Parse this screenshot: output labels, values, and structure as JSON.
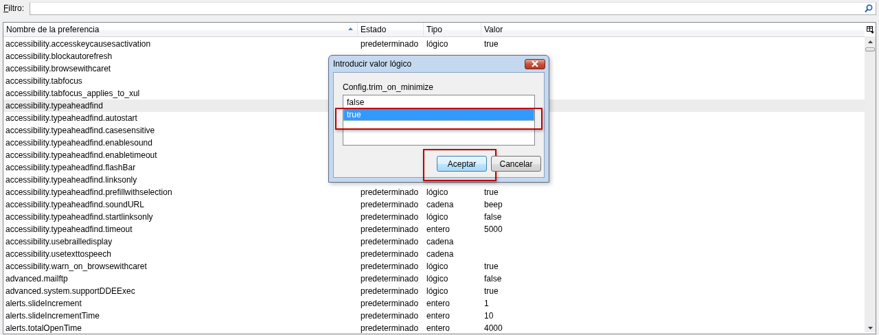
{
  "filter": {
    "label": "Filtro:"
  },
  "table": {
    "columns": [
      {
        "label": "Nombre de la preferencia",
        "sorted": true
      },
      {
        "label": "Estado",
        "sorted": false
      },
      {
        "label": "Tipo",
        "sorted": false
      },
      {
        "label": "Valor",
        "sorted": false
      }
    ],
    "rows": [
      {
        "name": "accessibility.accesskeycausesactivation",
        "estado": "predeterminado",
        "tipo": "lógico",
        "valor": "true",
        "selected": false
      },
      {
        "name": "accessibility.blockautorefresh",
        "selected": false
      },
      {
        "name": "accessibility.browsewithcaret",
        "selected": false
      },
      {
        "name": "accessibility.tabfocus",
        "selected": false
      },
      {
        "name": "accessibility.tabfocus_applies_to_xul",
        "selected": false
      },
      {
        "name": "accessibility.typeaheadfind",
        "selected": true
      },
      {
        "name": "accessibility.typeaheadfind.autostart",
        "selected": false
      },
      {
        "name": "accessibility.typeaheadfind.casesensitive",
        "selected": false
      },
      {
        "name": "accessibility.typeaheadfind.enablesound",
        "selected": false
      },
      {
        "name": "accessibility.typeaheadfind.enabletimeout",
        "selected": false
      },
      {
        "name": "accessibility.typeaheadfind.flashBar",
        "selected": false
      },
      {
        "name": "accessibility.typeaheadfind.linksonly",
        "selected": false
      },
      {
        "name": "accessibility.typeaheadfind.prefillwithselection",
        "estado": "predeterminado",
        "tipo": "lógico",
        "valor": "true",
        "selected": false
      },
      {
        "name": "accessibility.typeaheadfind.soundURL",
        "estado": "predeterminado",
        "tipo": "cadena",
        "valor": "beep",
        "selected": false
      },
      {
        "name": "accessibility.typeaheadfind.startlinksonly",
        "estado": "predeterminado",
        "tipo": "lógico",
        "valor": "false",
        "selected": false
      },
      {
        "name": "accessibility.typeaheadfind.timeout",
        "estado": "predeterminado",
        "tipo": "entero",
        "valor": "5000",
        "selected": false
      },
      {
        "name": "accessibility.usebrailledisplay",
        "estado": "predeterminado",
        "tipo": "cadena",
        "selected": false
      },
      {
        "name": "accessibility.usetexttospeech",
        "estado": "predeterminado",
        "tipo": "cadena",
        "selected": false
      },
      {
        "name": "accessibility.warn_on_browsewithcaret",
        "estado": "predeterminado",
        "tipo": "lógico",
        "valor": "true",
        "selected": false
      },
      {
        "name": "advanced.mailftp",
        "estado": "predeterminado",
        "tipo": "lógico",
        "valor": "false",
        "selected": false
      },
      {
        "name": "advanced.system.supportDDEExec",
        "estado": "predeterminado",
        "tipo": "lógico",
        "valor": "true",
        "selected": false
      },
      {
        "name": "alerts.slideIncrement",
        "estado": "predeterminado",
        "tipo": "entero",
        "valor": "1",
        "selected": false
      },
      {
        "name": "alerts.slideIncrementTime",
        "estado": "predeterminado",
        "tipo": "entero",
        "valor": "10",
        "selected": false
      },
      {
        "name": "alerts.totalOpenTime",
        "estado": "predeterminado",
        "tipo": "entero",
        "valor": "4000",
        "selected": false
      }
    ]
  },
  "dialog": {
    "title": "Introducir valor lógico",
    "prompt": "Config.trim_on_minimize",
    "options": [
      {
        "label": "false",
        "selected": false,
        "highlighted": false
      },
      {
        "label": "true",
        "selected": true,
        "highlighted": true
      }
    ],
    "buttons": [
      {
        "label": "Aceptar",
        "default": true,
        "highlighted": true
      },
      {
        "label": "Cancelar",
        "default": false,
        "highlighted": false
      }
    ]
  }
}
